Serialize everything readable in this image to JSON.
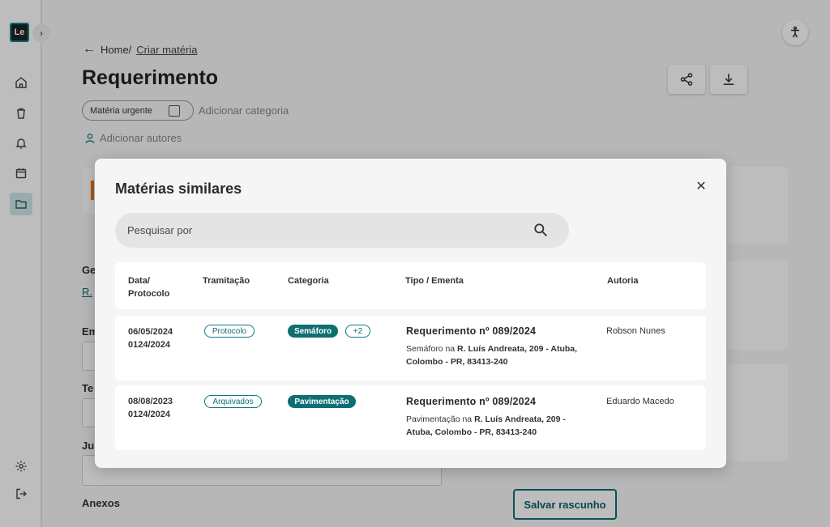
{
  "app": {
    "logo_text": "Le",
    "expand_icon": "chevron-right-icon",
    "accent_color": "#0e6f73"
  },
  "sidebar": {
    "items": [
      {
        "name": "home",
        "icon": "home-icon"
      },
      {
        "name": "trash",
        "icon": "trash-icon"
      },
      {
        "name": "notifications",
        "icon": "bell-icon"
      },
      {
        "name": "calendar",
        "icon": "calendar-icon"
      },
      {
        "name": "folder",
        "icon": "folder-icon",
        "active": true
      }
    ],
    "bottom": [
      {
        "name": "settings",
        "icon": "gear-icon"
      },
      {
        "name": "logout",
        "icon": "logout-icon"
      }
    ]
  },
  "breadcrumb": {
    "home": "Home/",
    "current": "Criar matéria"
  },
  "page": {
    "title": "Requerimento",
    "urgent_label": "Matéria urgente",
    "add_category": "Adicionar categoria",
    "add_authors": "Adicionar autores",
    "labels": {
      "anexos": "Anexos",
      "ge": "Ge",
      "r": "R.",
      "em": "Em",
      "te": "Te",
      "ju": "Ju"
    },
    "save_draft": "Salvar rascunho"
  },
  "modal": {
    "title": "Matérias similares",
    "search_placeholder": "Pesquisar por",
    "headers": {
      "data_line1": "Data/",
      "data_line2": "Protocolo",
      "tramitacao": "Tramitação",
      "categoria": "Categoria",
      "tipo": "Tipo / Ementa",
      "autoria": "Autoria"
    },
    "rows": [
      {
        "date": "06/05/2024",
        "protocol": "0124/2024",
        "tramitacao": "Protocolo",
        "categoria": "Semáforo",
        "extra_categories": "+2",
        "tipo": "Requerimento nº 089/2024",
        "ementa_prefix": "Semáforo na ",
        "ementa_address": "R. Luís Andreata, 209 - Atuba, Colombo - PR, 83413-240",
        "autoria": "Robson Nunes"
      },
      {
        "date": "08/08/2023",
        "protocol": "0124/2024",
        "tramitacao": "Arquivados",
        "categoria": "Pavimentação",
        "tipo": "Requerimento nº 089/2024",
        "ementa_prefix": "Pavimentação na ",
        "ementa_address": "R. Luís Andreata, 209 - Atuba, Colombo - PR, 83413-240",
        "autoria": "Eduardo Macedo"
      }
    ]
  }
}
